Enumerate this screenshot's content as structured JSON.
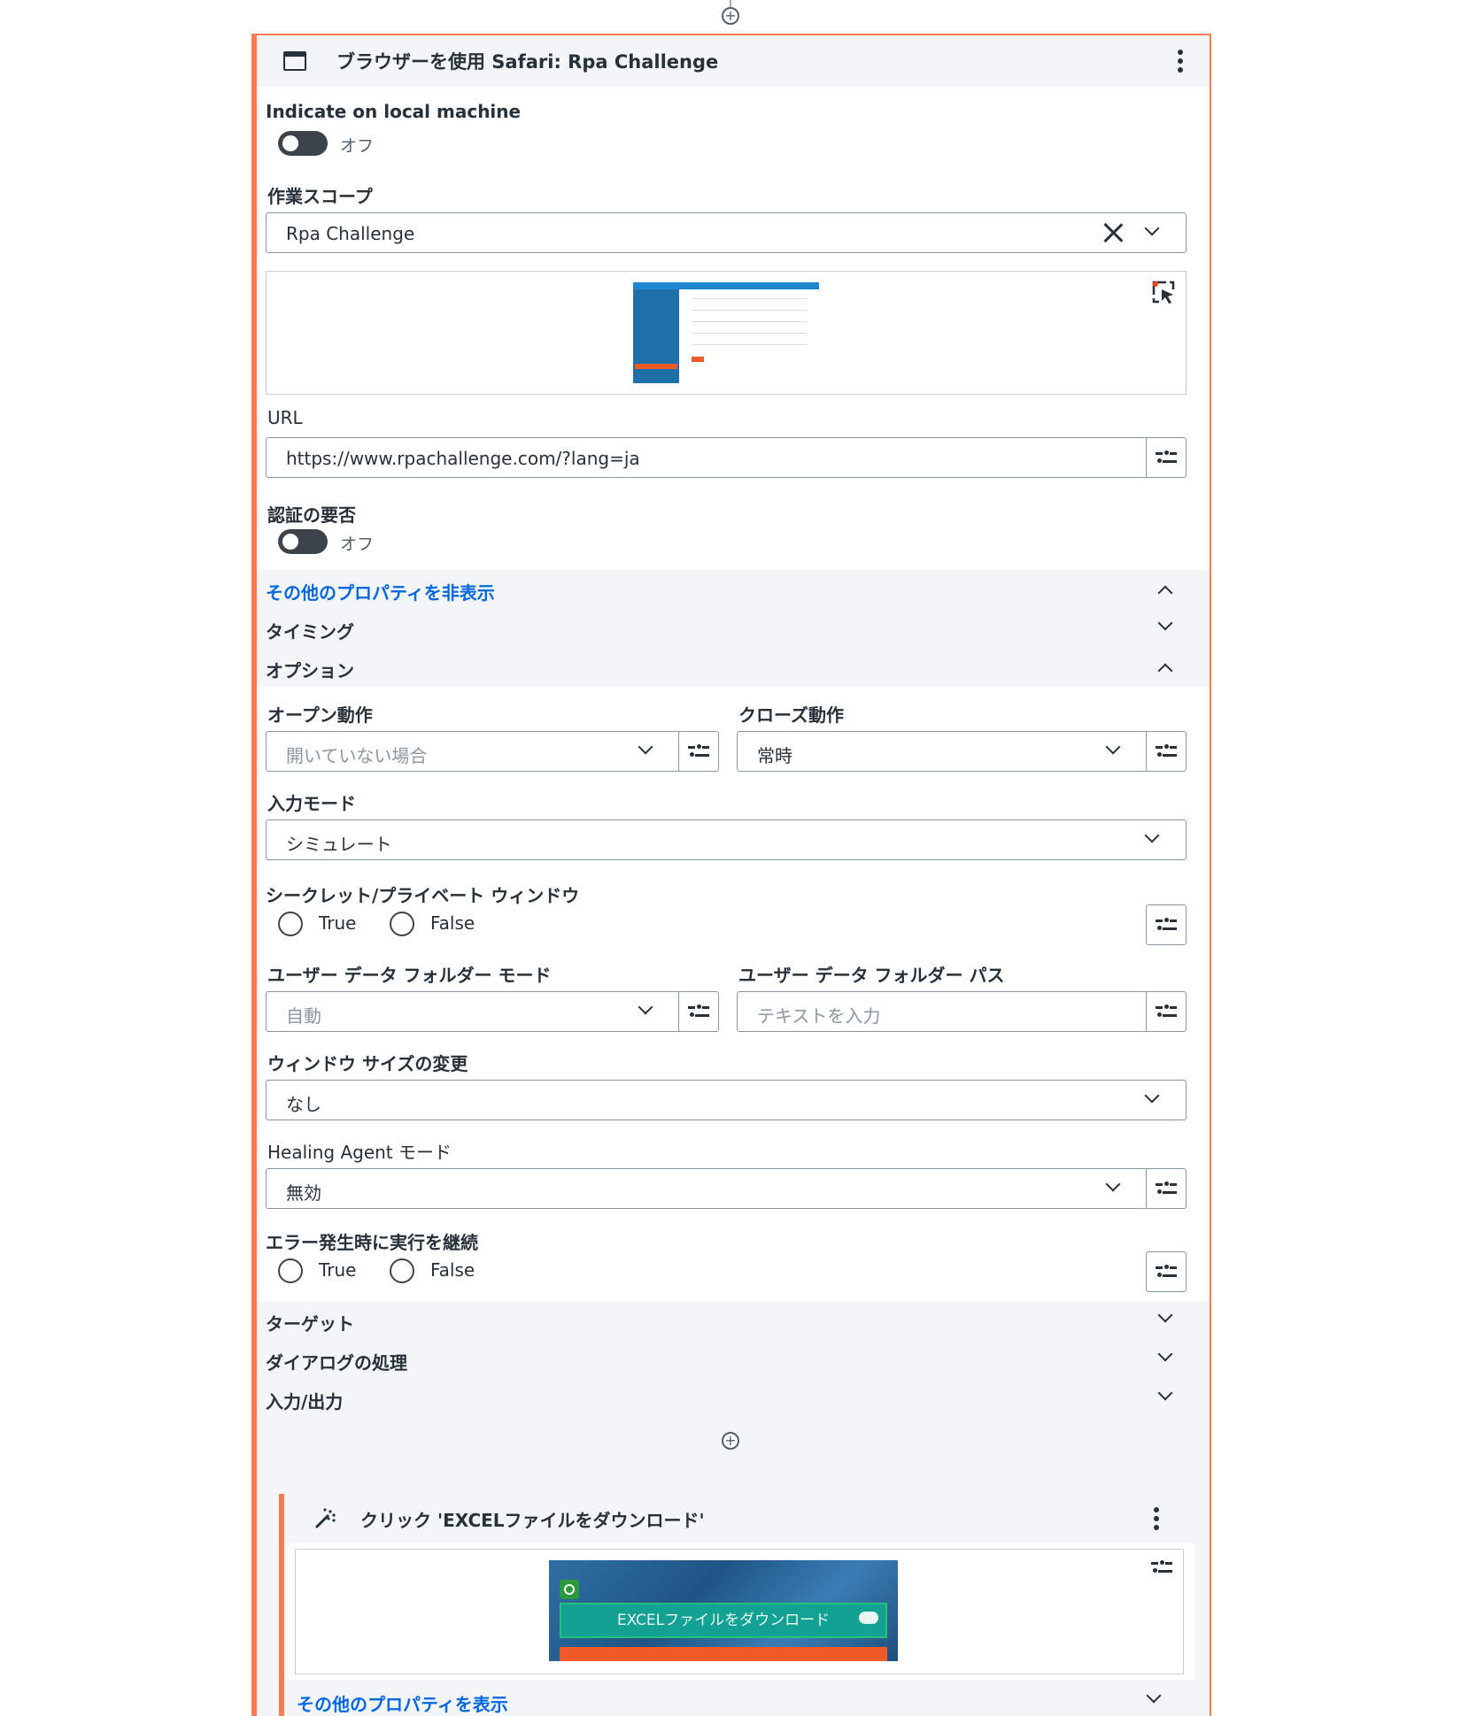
{
  "activity": {
    "title": "ブラウザーを使用 Safari: Rpa Challenge",
    "indicate_label": "Indicate on local machine",
    "indicate_toggle": "オフ",
    "scope_label": "作業スコープ",
    "scope_value": "Rpa Challenge",
    "url_label": "URL",
    "url_value": "https://www.rpachallenge.com/?lang=ja",
    "auth_label": "認証の要否",
    "auth_toggle": "オフ"
  },
  "sections": {
    "hide_more": "その他のプロパティを非表示",
    "timing": "タイミング",
    "options": "オプション",
    "target": "ターゲット",
    "dialog": "ダイアログの処理",
    "io": "入力/出力"
  },
  "options": {
    "open_label": "オープン動作",
    "open_placeholder": "開いていない場合",
    "close_label": "クローズ動作",
    "close_value": "常時",
    "input_mode_label": "入力モード",
    "input_mode_value": "シミュレート",
    "private_label": "シークレット/プライベート ウィンドウ",
    "true_label": "True",
    "false_label": "False",
    "user_folder_mode_label": "ユーザー データ フォルダー モード",
    "user_folder_mode_placeholder": "自動",
    "user_folder_path_label": "ユーザー データ フォルダー パス",
    "user_folder_path_placeholder": "テキストを入力",
    "resize_label": "ウィンドウ サイズの変更",
    "resize_value": "なし",
    "healing_label": "Healing Agent モード",
    "healing_value": "無効",
    "continue_label": "エラー発生時に実行を継続"
  },
  "inner": {
    "title": "クリック 'EXCELファイルをダウンロード'",
    "button_text": "EXCELファイルをダウンロード",
    "show_more": "その他のプロパティを表示"
  },
  "icons": {
    "window": "browser-window-icon",
    "more": "kebab-menu-icon",
    "clear": "close-icon",
    "dropdown": "chevron-down-icon",
    "options": "property-options-icon",
    "target": "indicate-target-icon",
    "wand": "magic-wand-icon",
    "add": "add-activity-icon"
  },
  "colors": {
    "accent": "#fa7a52",
    "link": "#0067df",
    "text": "#273139",
    "section_bg": "#f4f5f7"
  }
}
